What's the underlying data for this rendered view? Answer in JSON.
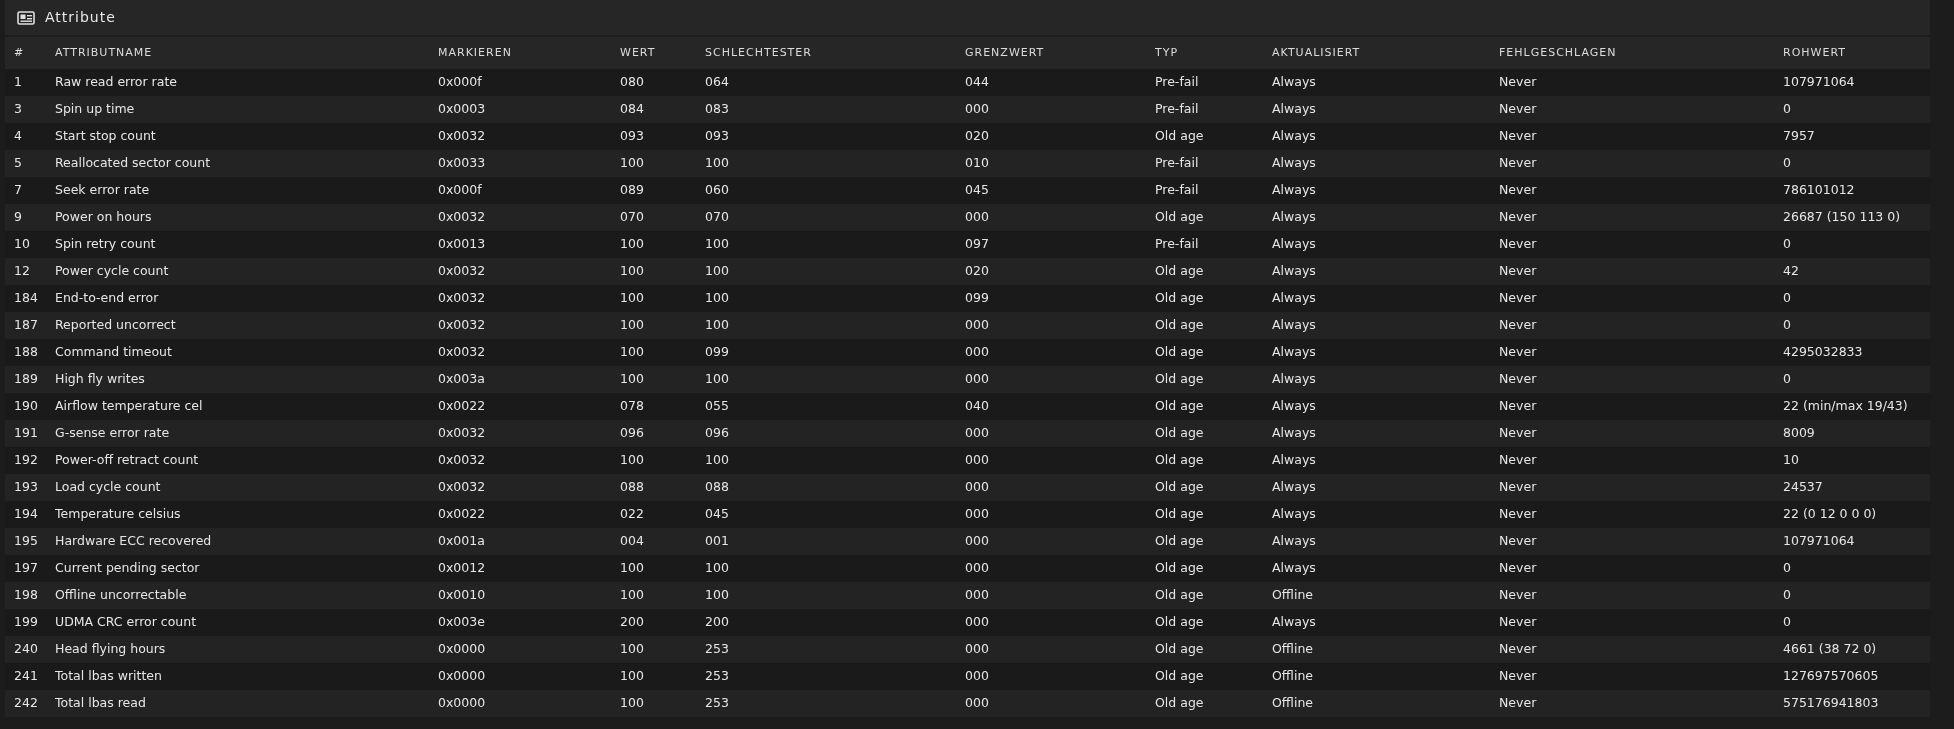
{
  "panel": {
    "title": "Attribute"
  },
  "table": {
    "columns": [
      "#",
      "ATTRIBUTNAME",
      "MARKIEREN",
      "WERT",
      "SCHLECHTESTER",
      "GRENZWERT",
      "TYP",
      "AKTUALISIERT",
      "FEHLGESCHLAGEN",
      "ROHWERT"
    ],
    "rows": [
      [
        "1",
        "Raw read error rate",
        "0x000f",
        "080",
        "064",
        "044",
        "Pre-fail",
        "Always",
        "Never",
        "107971064"
      ],
      [
        "3",
        "Spin up time",
        "0x0003",
        "084",
        "083",
        "000",
        "Pre-fail",
        "Always",
        "Never",
        "0"
      ],
      [
        "4",
        "Start stop count",
        "0x0032",
        "093",
        "093",
        "020",
        "Old age",
        "Always",
        "Never",
        "7957"
      ],
      [
        "5",
        "Reallocated sector count",
        "0x0033",
        "100",
        "100",
        "010",
        "Pre-fail",
        "Always",
        "Never",
        "0"
      ],
      [
        "7",
        "Seek error rate",
        "0x000f",
        "089",
        "060",
        "045",
        "Pre-fail",
        "Always",
        "Never",
        "786101012"
      ],
      [
        "9",
        "Power on hours",
        "0x0032",
        "070",
        "070",
        "000",
        "Old age",
        "Always",
        "Never",
        "26687 (150 113 0)"
      ],
      [
        "10",
        "Spin retry count",
        "0x0013",
        "100",
        "100",
        "097",
        "Pre-fail",
        "Always",
        "Never",
        "0"
      ],
      [
        "12",
        "Power cycle count",
        "0x0032",
        "100",
        "100",
        "020",
        "Old age",
        "Always",
        "Never",
        "42"
      ],
      [
        "184",
        "End-to-end error",
        "0x0032",
        "100",
        "100",
        "099",
        "Old age",
        "Always",
        "Never",
        "0"
      ],
      [
        "187",
        "Reported uncorrect",
        "0x0032",
        "100",
        "100",
        "000",
        "Old age",
        "Always",
        "Never",
        "0"
      ],
      [
        "188",
        "Command timeout",
        "0x0032",
        "100",
        "099",
        "000",
        "Old age",
        "Always",
        "Never",
        "4295032833"
      ],
      [
        "189",
        "High fly writes",
        "0x003a",
        "100",
        "100",
        "000",
        "Old age",
        "Always",
        "Never",
        "0"
      ],
      [
        "190",
        "Airflow temperature cel",
        "0x0022",
        "078",
        "055",
        "040",
        "Old age",
        "Always",
        "Never",
        "22 (min/max 19/43)"
      ],
      [
        "191",
        "G-sense error rate",
        "0x0032",
        "096",
        "096",
        "000",
        "Old age",
        "Always",
        "Never",
        "8009"
      ],
      [
        "192",
        "Power-off retract count",
        "0x0032",
        "100",
        "100",
        "000",
        "Old age",
        "Always",
        "Never",
        "10"
      ],
      [
        "193",
        "Load cycle count",
        "0x0032",
        "088",
        "088",
        "000",
        "Old age",
        "Always",
        "Never",
        "24537"
      ],
      [
        "194",
        "Temperature celsius",
        "0x0022",
        "022",
        "045",
        "000",
        "Old age",
        "Always",
        "Never",
        "22 (0 12 0 0 0)"
      ],
      [
        "195",
        "Hardware ECC recovered",
        "0x001a",
        "004",
        "001",
        "000",
        "Old age",
        "Always",
        "Never",
        "107971064"
      ],
      [
        "197",
        "Current pending sector",
        "0x0012",
        "100",
        "100",
        "000",
        "Old age",
        "Always",
        "Never",
        "0"
      ],
      [
        "198",
        "Offline uncorrectable",
        "0x0010",
        "100",
        "100",
        "000",
        "Old age",
        "Offline",
        "Never",
        "0"
      ],
      [
        "199",
        "UDMA CRC error count",
        "0x003e",
        "200",
        "200",
        "000",
        "Old age",
        "Always",
        "Never",
        "0"
      ],
      [
        "240",
        "Head flying hours",
        "0x0000",
        "100",
        "253",
        "000",
        "Old age",
        "Offline",
        "Never",
        "4661 (38 72 0)"
      ],
      [
        "241",
        "Total lbas written",
        "0x0000",
        "100",
        "253",
        "000",
        "Old age",
        "Offline",
        "Never",
        "127697570605"
      ],
      [
        "242",
        "Total lbas read",
        "0x0000",
        "100",
        "253",
        "000",
        "Old age",
        "Offline",
        "Never",
        "575176941803"
      ]
    ]
  }
}
